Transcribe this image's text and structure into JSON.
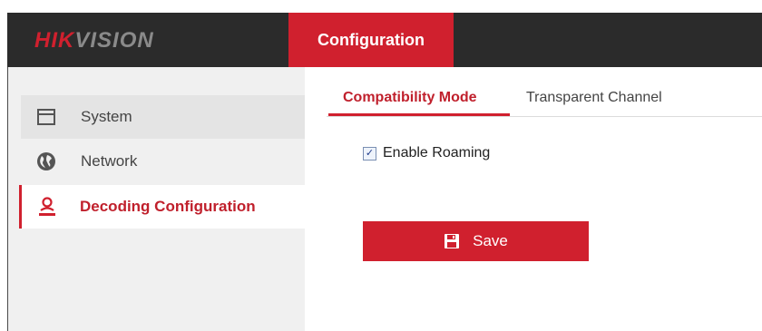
{
  "header": {
    "logo_hik": "HIK",
    "logo_vision": "VISION",
    "active_tab": "Configuration"
  },
  "sidebar": {
    "items": [
      {
        "label": "System",
        "icon": "window-icon"
      },
      {
        "label": "Network",
        "icon": "globe-icon"
      },
      {
        "label": "Decoding Configuration",
        "icon": "user-icon"
      }
    ]
  },
  "content": {
    "tabs": [
      {
        "label": "Compatibility Mode",
        "active": true
      },
      {
        "label": "Transparent Channel",
        "active": false
      }
    ],
    "enable_roaming": {
      "label": "Enable Roaming",
      "checked": true
    },
    "save_label": "Save"
  },
  "colors": {
    "brand_red": "#d0202e",
    "topbar": "#2b2b2b",
    "sidebar_bg": "#f0f0f0"
  }
}
